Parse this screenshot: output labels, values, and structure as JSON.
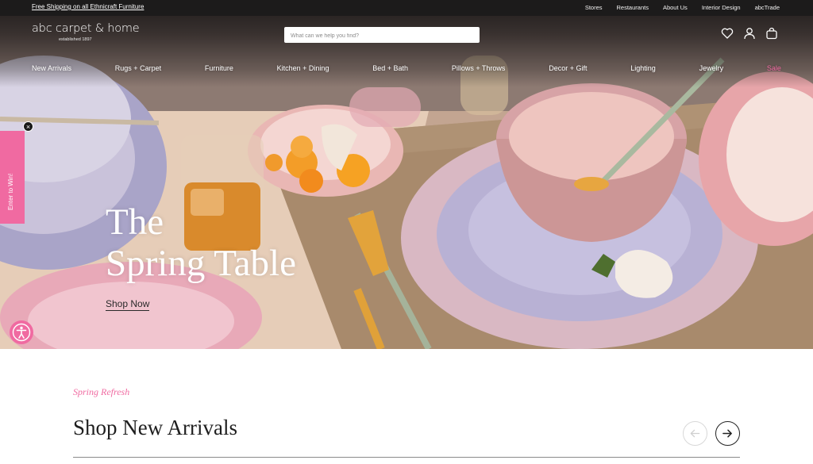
{
  "utility": {
    "promo": "Free Shipping on all Ethnicraft Furniture",
    "links": [
      "Stores",
      "Restaurants",
      "About Us",
      "Interior Design",
      "abcTrade"
    ]
  },
  "brand": {
    "name": "abc carpet & home",
    "tagline": "established 1897"
  },
  "search": {
    "placeholder": "What can we help you find?"
  },
  "header_icons": [
    "heart-icon",
    "account-icon",
    "bag-icon"
  ],
  "nav": {
    "items": [
      "New Arrivals",
      "Rugs + Carpet",
      "Furniture",
      "Kitchen + Dining",
      "Bed + Bath",
      "Pillows + Throws",
      "Decor + Gift",
      "Lighting",
      "Jewelry",
      "Sale"
    ]
  },
  "hero": {
    "title_line1": "The",
    "title_line2": "Spring Table",
    "cta": "Shop Now"
  },
  "side_tab": {
    "label": "Enter to Win!",
    "close": "×"
  },
  "section": {
    "kicker": "Spring Refresh",
    "title": "Shop New Arrivals"
  },
  "colors": {
    "accent_pink": "#f06aa1",
    "header_dark": "#1c1b1b",
    "text_dark": "#1e1e1e"
  }
}
